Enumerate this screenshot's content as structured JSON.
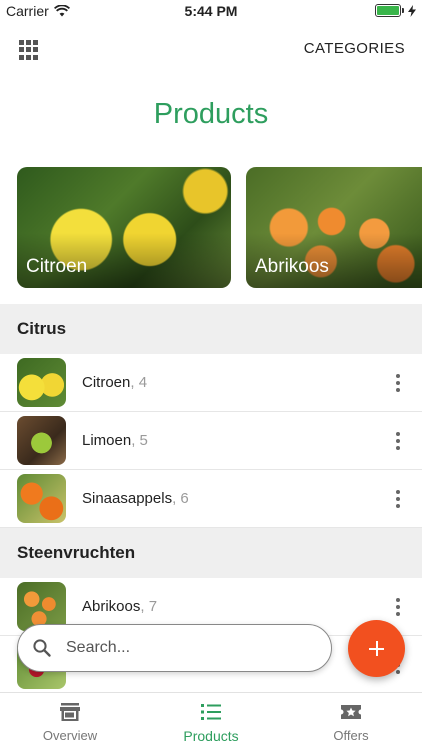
{
  "status_bar": {
    "carrier": "Carrier",
    "time": "5:44 PM",
    "battery_fill": 1.0
  },
  "header": {
    "categories_label": "CATEGORIES",
    "title": "Products"
  },
  "featured": [
    {
      "label": "Citroen"
    },
    {
      "label": "Abrikoos"
    }
  ],
  "sections": [
    {
      "title": "Citrus",
      "items": [
        {
          "name": "Citroen",
          "count": ", 4"
        },
        {
          "name": "Limoen",
          "count": ", 5"
        },
        {
          "name": "Sinaasappels",
          "count": ", 6"
        }
      ]
    },
    {
      "title": "Steenvruchten",
      "items": [
        {
          "name": "Abrikoos",
          "count": ", 7"
        }
      ]
    }
  ],
  "search": {
    "placeholder": "Search..."
  },
  "tabs": [
    {
      "label": "Overview",
      "icon": "store-icon"
    },
    {
      "label": "Products",
      "icon": "list-icon",
      "active": true
    },
    {
      "label": "Offers",
      "icon": "ticket-star-icon"
    }
  ],
  "colors": {
    "accent_green": "#2e9e5e",
    "fab_orange": "#f2501f",
    "section_bg": "#efefef"
  }
}
